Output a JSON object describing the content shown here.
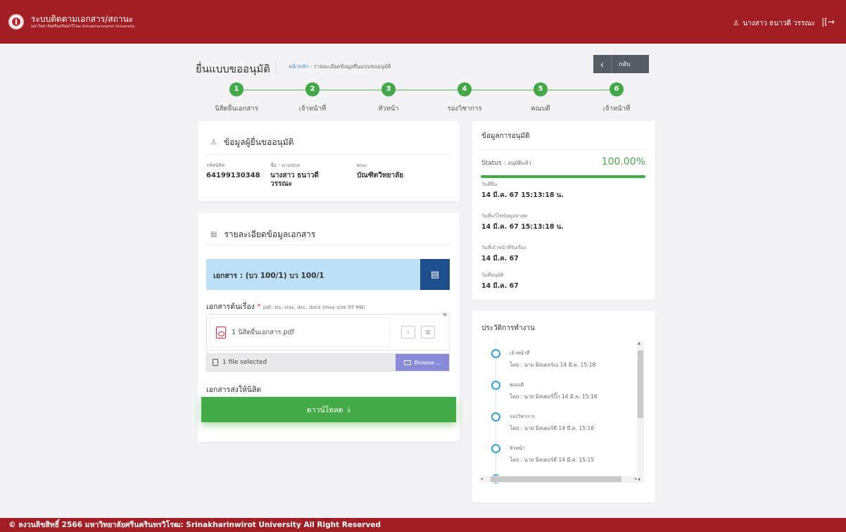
{
  "header": {
    "title": "ระบบติดตามเอกสาร/สถานะ",
    "subtitle": "มหาวิทยาลัยศรีนครินทรวิโรฒ Srinakharinwirot University",
    "user_name": "นางสาว ธนาวดี วรรณะ",
    "logout_glyph": "|[→"
  },
  "page": {
    "title": "ยื่นแบบขออนุมัติ",
    "breadcrumb_home": "หน้าหลัก",
    "breadcrumb_sep": "-",
    "breadcrumb_current": "รายละเอียดข้อมูลยื่นแบบขออนุมัติ",
    "back_label": "กลับ",
    "back_glyph": "‹"
  },
  "steps": [
    {
      "num": "1",
      "label": "นิสิตยื่นเอกสาร"
    },
    {
      "num": "2",
      "label": "เจ้าหน้าที่"
    },
    {
      "num": "3",
      "label": "หัวหน้า"
    },
    {
      "num": "4",
      "label": "รองวิชาการ"
    },
    {
      "num": "5",
      "label": "คณบดี"
    },
    {
      "num": "6",
      "label": "เจ้าหน้าที่"
    }
  ],
  "applicant": {
    "title": "ข้อมูลผู้ยื่นขออนุมัติ",
    "id_label": "รหัสนิสิต",
    "id_value": "64199130348",
    "name_label": "ชื่อ - นามสกุล",
    "name_value_1": "นางสาว ธนาวดี",
    "name_value_2": "วรรณะ",
    "faculty_label": "คณะ",
    "faculty_value": "บัณฑิตวิทยาลัย"
  },
  "document": {
    "title": "รายละเอียดข้อมูลเอกสาร",
    "doc_name": "เอกสาร : (บว 100/1) บว 100/1",
    "source_label": "เอกสารต้นเรื่อง",
    "required_mark": "*",
    "source_hint": "pdf, xls, xlsx, doc, docx (max size 97 MB)",
    "file_name": "1 นิสิตยื่นเอกสาร.pdf",
    "close_glyph": "×",
    "selected_text": "1 file selected",
    "browse_label": "Browse ...",
    "send_label": "เอกสารส่งให้นิสิต",
    "download_label": "ดาวน์โหลด",
    "download_glyph": "⤓"
  },
  "approval": {
    "title": "ข้อมูลการอนุมัติ",
    "status_label": "Status :",
    "status_value": "อนุมัติแล้ว",
    "percent": "100.00%",
    "progress_fraction": 1.0,
    "submitted_label": "วันที่ยื่น",
    "submitted_value": "14 มี.ค. 67 15:13:18 น.",
    "updated_label": "วันที่แก้ไขข้อมูลล่าสุด",
    "updated_value": "14 มี.ค. 67 15:13:18 น.",
    "received_label": "วันที่เจ้าหน้าที่รับเรื่อง",
    "received_value": "14 มี.ค. 67",
    "approved_label": "วันที่อนุมัติ",
    "approved_value": "14 มี.ค. 67"
  },
  "history": {
    "title": "ประวัติการทำงาน",
    "items": [
      {
        "role": "เจ้าหน้าที่",
        "by": "โดย : นาย มิสเตอร์เอ 14 มี.ค. 15:18"
      },
      {
        "role": "คณบดี",
        "by": "โดย : นาย มิสเตอร์บิ๊ก 14 มี.ค. 15:16"
      },
      {
        "role": "รองวิชาการ",
        "by": "โดย : นาย มิสเตอร์ดี 14 มี.ค. 15:16"
      },
      {
        "role": "หัวหน้า",
        "by": "โดย : นาย มิสเตอร์ดี 14 มี.ค. 15:15"
      }
    ]
  },
  "footer": {
    "text": "© ลงวนลิขสิทธิ์ 2566 มหาวิทยาลัยศรีนครินทรวิโรฒ: Srinakharinwirot University All Right Reserved"
  },
  "colors": {
    "brand": "#a11f24",
    "success": "#43a847",
    "doc_bar": "#bde0f7",
    "doc_btn": "#1e4f8c",
    "browse": "#8a8bd8",
    "timeline": "#2fa0e0"
  }
}
